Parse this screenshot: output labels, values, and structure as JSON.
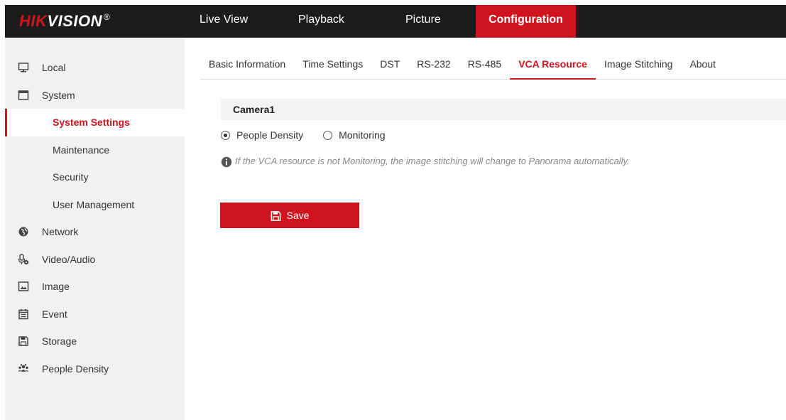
{
  "brand": {
    "hik": "HIK",
    "vision": "VISION",
    "reg": "®"
  },
  "topnav": {
    "live_view": "Live View",
    "playback": "Playback",
    "picture": "Picture",
    "configuration": "Configuration"
  },
  "sidebar": {
    "local": "Local",
    "system": "System",
    "system_settings": "System Settings",
    "maintenance": "Maintenance",
    "security": "Security",
    "user_management": "User Management",
    "network": "Network",
    "video_audio": "Video/Audio",
    "image": "Image",
    "event": "Event",
    "storage": "Storage",
    "people_density": "People Density"
  },
  "tabs": {
    "basic_information": "Basic Information",
    "time_settings": "Time Settings",
    "dst": "DST",
    "rs232": "RS-232",
    "rs485": "RS-485",
    "vca_resource": "VCA Resource",
    "image_stitching": "Image Stitching",
    "about": "About"
  },
  "content": {
    "section_title": "Camera1",
    "option_people_density": "People Density",
    "option_monitoring": "Monitoring",
    "selected": "People Density",
    "note": "If the VCA resource is not Monitoring, the image stitching will change to Panorama automatically.",
    "save_label": "Save"
  },
  "colors": {
    "accent": "#d0141f",
    "topbar": "#1c1c1c",
    "sidebar": "#f1f1f1"
  }
}
